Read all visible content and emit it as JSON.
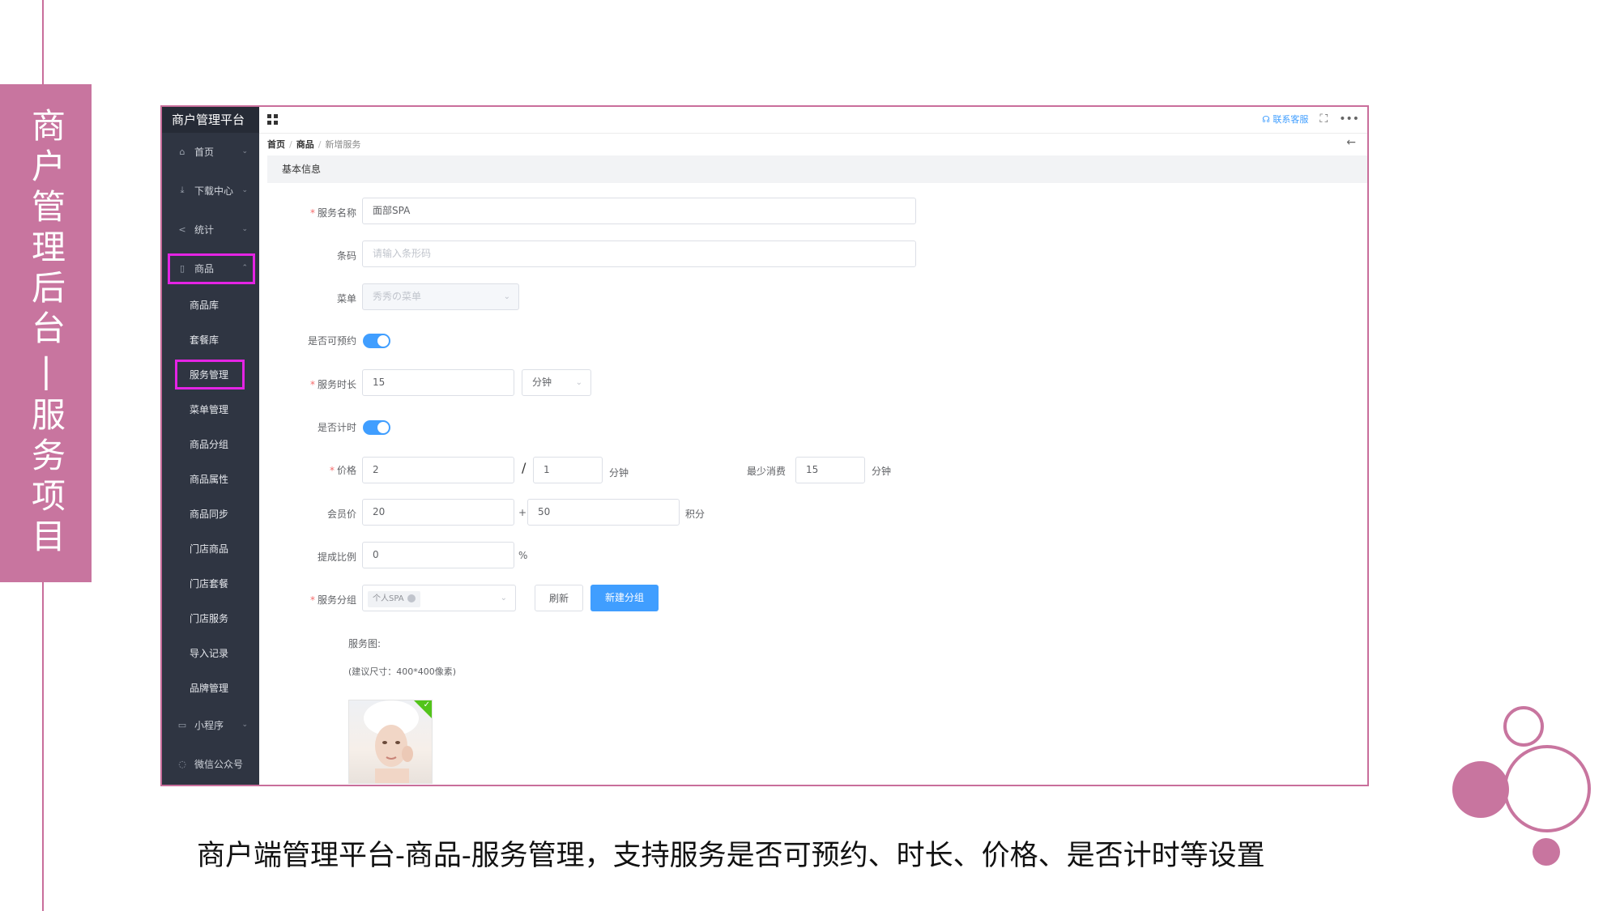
{
  "slide": {
    "side_title": "商户管理后台|服务项目",
    "caption": "商户端管理平台-商品-服务管理，支持服务是否可预约、时长、价格、是否计时等设置",
    "accent_color": "#c8759f",
    "highlight_color": "#e424e4"
  },
  "app": {
    "brand": "商户管理平台",
    "contact_service": "联系客服",
    "icons": [
      "grid-icon",
      "headset-icon",
      "fullscreen-icon",
      "more-icon",
      "back-arrow-icon"
    ]
  },
  "sidebar": {
    "items": [
      {
        "label": "首页",
        "icon": "home-icon"
      },
      {
        "label": "下载中心",
        "icon": "download-icon"
      },
      {
        "label": "统计",
        "icon": "share-icon"
      },
      {
        "label": "商品",
        "icon": "bag-icon"
      },
      {
        "label": "小程序",
        "icon": "phone-icon"
      },
      {
        "label": "微信公众号",
        "icon": "chat-icon"
      }
    ],
    "sub_items": [
      "商品库",
      "套餐库",
      "服务管理",
      "菜单管理",
      "商品分组",
      "商品属性",
      "商品同步",
      "门店商品",
      "门店套餐",
      "门店服务",
      "导入记录",
      "品牌管理"
    ]
  },
  "breadcrumb": [
    "首页",
    "商品",
    "新增服务"
  ],
  "section_title": "基本信息",
  "form": {
    "name_label": "服务名称",
    "name_value": "面部SPA",
    "barcode_label": "条码",
    "barcode_placeholder": "请输入条形码",
    "menu_label": "菜单",
    "menu_value": "秀秀の菜单",
    "bookable_label": "是否可预约",
    "bookable_on": true,
    "duration_label": "服务时长",
    "duration_value": "15",
    "duration_unit": "分钟",
    "timing_label": "是否计时",
    "timing_on": true,
    "price_label": "价格",
    "price_value": "2",
    "price_slash": "/",
    "price_per": "1",
    "price_per_unit": "分钟",
    "min_spend_label": "最少消费",
    "min_spend_value": "15",
    "min_spend_unit": "分钟",
    "member_label": "会员价",
    "member_value": "20",
    "member_plus": "+",
    "member_points": "50",
    "member_points_unit": "积分",
    "commission_label": "提成比例",
    "commission_value": "0",
    "commission_unit": "%",
    "group_label": "服务分组",
    "group_tag": "个人SPA",
    "refresh_btn": "刷新",
    "new_group_btn": "新建分组",
    "image_label": "服务图:",
    "image_hint": "(建议尺寸：400*400像素)"
  }
}
